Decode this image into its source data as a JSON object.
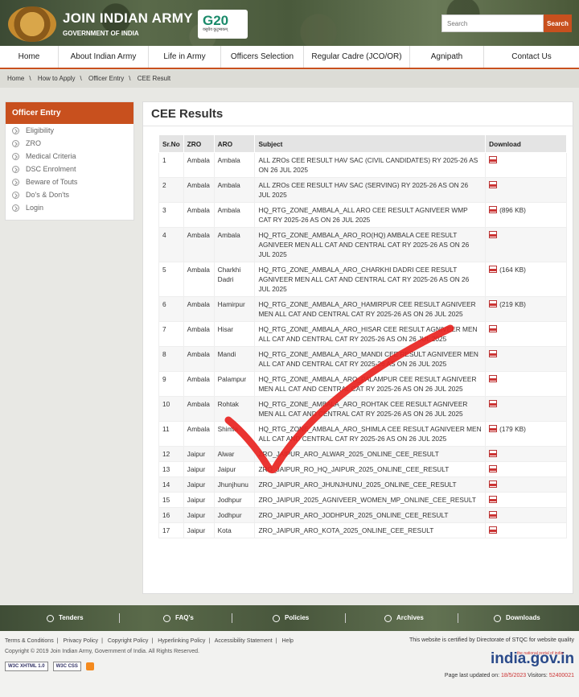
{
  "header": {
    "title": "JOIN INDIAN ARMY",
    "subtitle": "GOVERNMENT OF INDIA",
    "g20_logo": "G20",
    "search_placeholder": "Search",
    "search_button": "Search"
  },
  "nav": [
    {
      "label": "Home"
    },
    {
      "label": "About Indian Army"
    },
    {
      "label": "Life in Army"
    },
    {
      "label": "Officers Selection"
    },
    {
      "label": "Regular Cadre (JCO/OR)"
    },
    {
      "label": "Agnipath"
    },
    {
      "label": "Contact Us"
    }
  ],
  "breadcrumb": [
    "Home",
    "How to Apply",
    "Officer Entry",
    "CEE Result"
  ],
  "sidebar": {
    "title": "Officer Entry",
    "items": [
      "Eligibility",
      "ZRO",
      "Medical Criteria",
      "DSC Enrolment",
      "Beware of Touts",
      "Do's & Don'ts",
      "Login"
    ]
  },
  "main": {
    "title": "CEE Results",
    "columns": [
      "Sr.No",
      "ZRO",
      "ARO",
      "Subject",
      "Download"
    ],
    "rows": [
      {
        "no": "1",
        "zro": "Ambala",
        "aro": "Ambala",
        "subject": "ALL ZROs CEE RESULT HAV SAC (CIVIL CANDIDATES) RY 2025-26 AS ON 26 JUL 2025",
        "size": ""
      },
      {
        "no": "2",
        "zro": "Ambala",
        "aro": "Ambala",
        "subject": "ALL ZROs CEE RESULT HAV SAC (SERVING) RY 2025-26 AS ON 26 JUL 2025",
        "size": ""
      },
      {
        "no": "3",
        "zro": "Ambala",
        "aro": "Ambala",
        "subject": "HQ_RTG_ZONE_AMBALA_ALL ARO CEE RESULT AGNIVEER WMP CAT RY 2025-26 AS ON 26 JUL 2025",
        "size": "(896 KB)"
      },
      {
        "no": "4",
        "zro": "Ambala",
        "aro": "Ambala",
        "subject": "HQ_RTG_ZONE_AMBALA_ARO_RO(HQ) AMBALA CEE RESULT AGNIVEER MEN ALL CAT AND CENTRAL CAT RY 2025-26 AS ON 26 JUL 2025",
        "size": ""
      },
      {
        "no": "5",
        "zro": "Ambala",
        "aro": "Charkhi Dadri",
        "subject": "HQ_RTG_ZONE_AMBALA_ARO_CHARKHI DADRI CEE RESULT AGNIVEER MEN ALL CAT AND CENTRAL CAT RY 2025-26 AS ON 26 JUL 2025",
        "size": "(164 KB)"
      },
      {
        "no": "6",
        "zro": "Ambala",
        "aro": "Hamirpur",
        "subject": "HQ_RTG_ZONE_AMBALA_ARO_HAMIRPUR CEE RESULT AGNIVEER MEN ALL CAT AND CENTRAL CAT RY 2025-26 AS ON 26 JUL 2025",
        "size": "(219 KB)"
      },
      {
        "no": "7",
        "zro": "Ambala",
        "aro": "Hisar",
        "subject": "HQ_RTG_ZONE_AMBALA_ARO_HISAR CEE RESULT AGNIVEER MEN ALL CAT AND CENTRAL CAT RY 2025-26 AS ON 26 JUL 2025",
        "size": ""
      },
      {
        "no": "8",
        "zro": "Ambala",
        "aro": "Mandi",
        "subject": "HQ_RTG_ZONE_AMBALA_ARO_MANDI CEE RESULT AGNIVEER MEN ALL CAT AND CENTRAL CAT RY 2025-26 AS ON 26 JUL 2025",
        "size": ""
      },
      {
        "no": "9",
        "zro": "Ambala",
        "aro": "Palampur",
        "subject": "HQ_RTG_ZONE_AMBALA_ARO_PALAMPUR CEE RESULT AGNIVEER MEN ALL CAT AND CENTRAL CAT RY 2025-26 AS ON 26 JUL 2025",
        "size": ""
      },
      {
        "no": "10",
        "zro": "Ambala",
        "aro": "Rohtak",
        "subject": "HQ_RTG_ZONE_AMBALA_ARO_ROHTAK CEE RESULT AGNIVEER MEN ALL CAT AND CENTRAL CAT RY 2025-26 AS ON 26 JUL 2025",
        "size": ""
      },
      {
        "no": "11",
        "zro": "Ambala",
        "aro": "Shimla",
        "subject": "HQ_RTG_ZONE_AMBALA_ARO_SHIMLA CEE RESULT AGNIVEER MEN ALL CAT AND CENTRAL CAT RY 2025-26 AS ON 26 JUL 2025",
        "size": "(179 KB)"
      },
      {
        "no": "12",
        "zro": "Jaipur",
        "aro": "Alwar",
        "subject": "ZRO_JAIPUR_ARO_ALWAR_2025_ONLINE_CEE_RESULT",
        "size": ""
      },
      {
        "no": "13",
        "zro": "Jaipur",
        "aro": "Jaipur",
        "subject": "ZRO_JAIPUR_RO_HQ_JAIPUR_2025_ONLINE_CEE_RESULT",
        "size": ""
      },
      {
        "no": "14",
        "zro": "Jaipur",
        "aro": "Jhunjhunu",
        "subject": "ZRO_JAIPUR_ARO_JHUNJHUNU_2025_ONLINE_CEE_RESULT",
        "size": ""
      },
      {
        "no": "15",
        "zro": "Jaipur",
        "aro": "Jodhpur",
        "subject": "ZRO_JAIPUR_2025_AGNIVEER_WOMEN_MP_ONLINE_CEE_RESULT",
        "size": ""
      },
      {
        "no": "16",
        "zro": "Jaipur",
        "aro": "Jodhpur",
        "subject": "ZRO_JAIPUR_ARO_JODHPUR_2025_ONLINE_CEE_RESULT",
        "size": ""
      },
      {
        "no": "17",
        "zro": "Jaipur",
        "aro": "Kota",
        "subject": "ZRO_JAIPUR_ARO_KOTA_2025_ONLINE_CEE_RESULT",
        "size": ""
      }
    ]
  },
  "footer_bar": [
    "Tenders",
    "FAQ's",
    "Policies",
    "Archives",
    "Downloads"
  ],
  "footer": {
    "links": [
      "Terms & Conditions",
      "Privacy Policy",
      "Copyright Policy",
      "Hyperlinking Policy",
      "Accessibility Statement",
      "Help"
    ],
    "copyright": "Copyright © 2019 Join Indian Army, Government of India. All Rights Reserved.",
    "certified": "This website is certified by Directorate of STQC for website quality",
    "badge_html": "W3C XHTML 1.0",
    "badge_css": "W3C CSS",
    "portal_logo": "india.gov.in",
    "portal_tag": "the national portal of india",
    "updated_label": "Page last updated on:",
    "updated_date": "18/5/2023",
    "visitors_label": "Visitors:",
    "visitors": "52400021"
  },
  "overlay": {
    "annotation": "red-checkmark",
    "color": "#e8231f"
  },
  "colors": {
    "accent": "#c8501e",
    "header_camo": "#4a5a3c"
  }
}
